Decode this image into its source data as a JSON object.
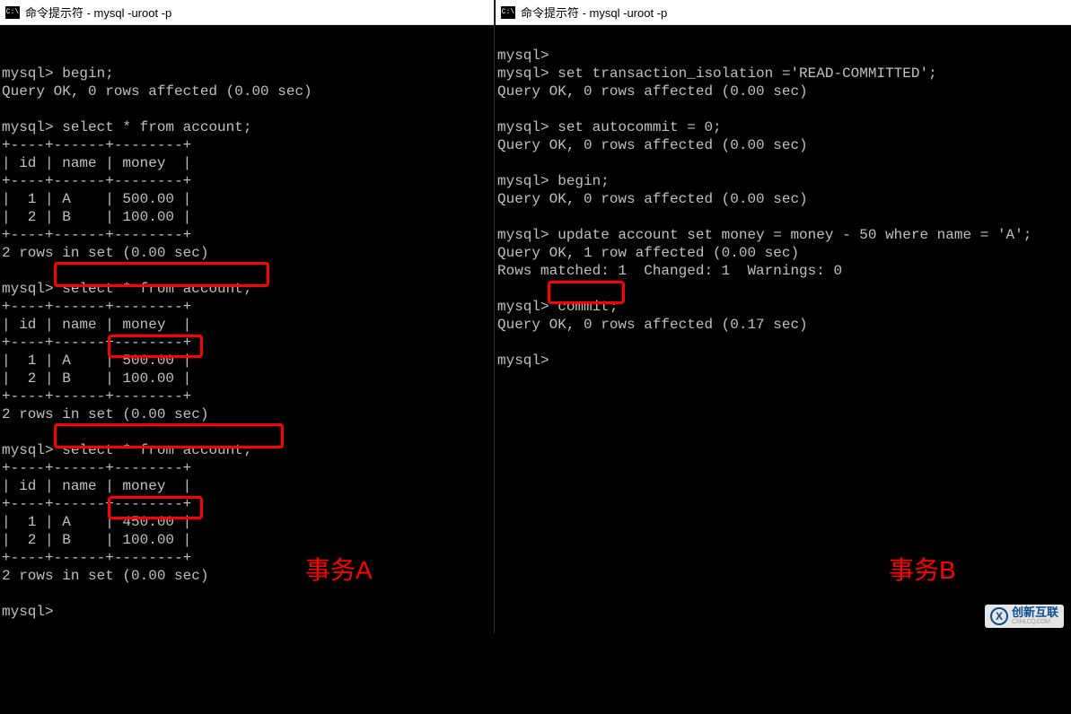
{
  "left": {
    "title": "命令提示符 - mysql  -uroot -p",
    "iconText": "C:\\",
    "lines": {
      "l1": "mysql> begin;",
      "l2": "Query OK, 0 rows affected (0.00 sec)",
      "l3": "",
      "l4": "mysql> select * from account;",
      "l5": "+----+------+--------+",
      "l6": "| id | name | money  |",
      "l7": "+----+------+--------+",
      "l8": "|  1 | A    | 500.00 |",
      "l9": "|  2 | B    | 100.00 |",
      "l10": "+----+------+--------+",
      "l11": "2 rows in set (0.00 sec)",
      "l12": "",
      "l13": "mysql> select * from account;",
      "l14": "+----+------+--------+",
      "l15": "| id | name | money  |",
      "l16": "+----+------+--------+",
      "l17": "|  1 | A    | 500.00 |",
      "l18": "|  2 | B    | 100.00 |",
      "l19": "+----+------+--------+",
      "l20": "2 rows in set (0.00 sec)",
      "l21": "",
      "l22": "mysql> select * from account;",
      "l23": "+----+------+--------+",
      "l24": "| id | name | money  |",
      "l25": "+----+------+--------+",
      "l26": "|  1 | A    | 450.00 |",
      "l27": "|  2 | B    | 100.00 |",
      "l28": "+----+------+--------+",
      "l29": "2 rows in set (0.00 sec)",
      "l30": "",
      "l31": "mysql>"
    },
    "label": "事务A"
  },
  "right": {
    "title": "命令提示符 - mysql  -uroot -p",
    "iconText": "C:\\",
    "lines": {
      "r1": "mysql>",
      "r2": "mysql> set transaction_isolation ='READ-COMMITTED';",
      "r3": "Query OK, 0 rows affected (0.00 sec)",
      "r4": "",
      "r5": "mysql> set autocommit = 0;",
      "r6": "Query OK, 0 rows affected (0.00 sec)",
      "r7": "",
      "r8": "mysql> begin;",
      "r9": "Query OK, 0 rows affected (0.00 sec)",
      "r10": "",
      "r11": "mysql> update account set money = money - 50 where name = 'A';",
      "r12": "Query OK, 1 row affected (0.00 sec)",
      "r13": "Rows matched: 1  Changed: 1  Warnings: 0",
      "r14": "",
      "r15": "mysql> commit;",
      "r16": "Query OK, 0 rows affected (0.17 sec)",
      "r17": "",
      "r18": "mysql>"
    },
    "label": "事务B"
  },
  "watermark": {
    "logoChar": "X",
    "cn": "创新互联",
    "en": "CXHLCQ.COM"
  }
}
